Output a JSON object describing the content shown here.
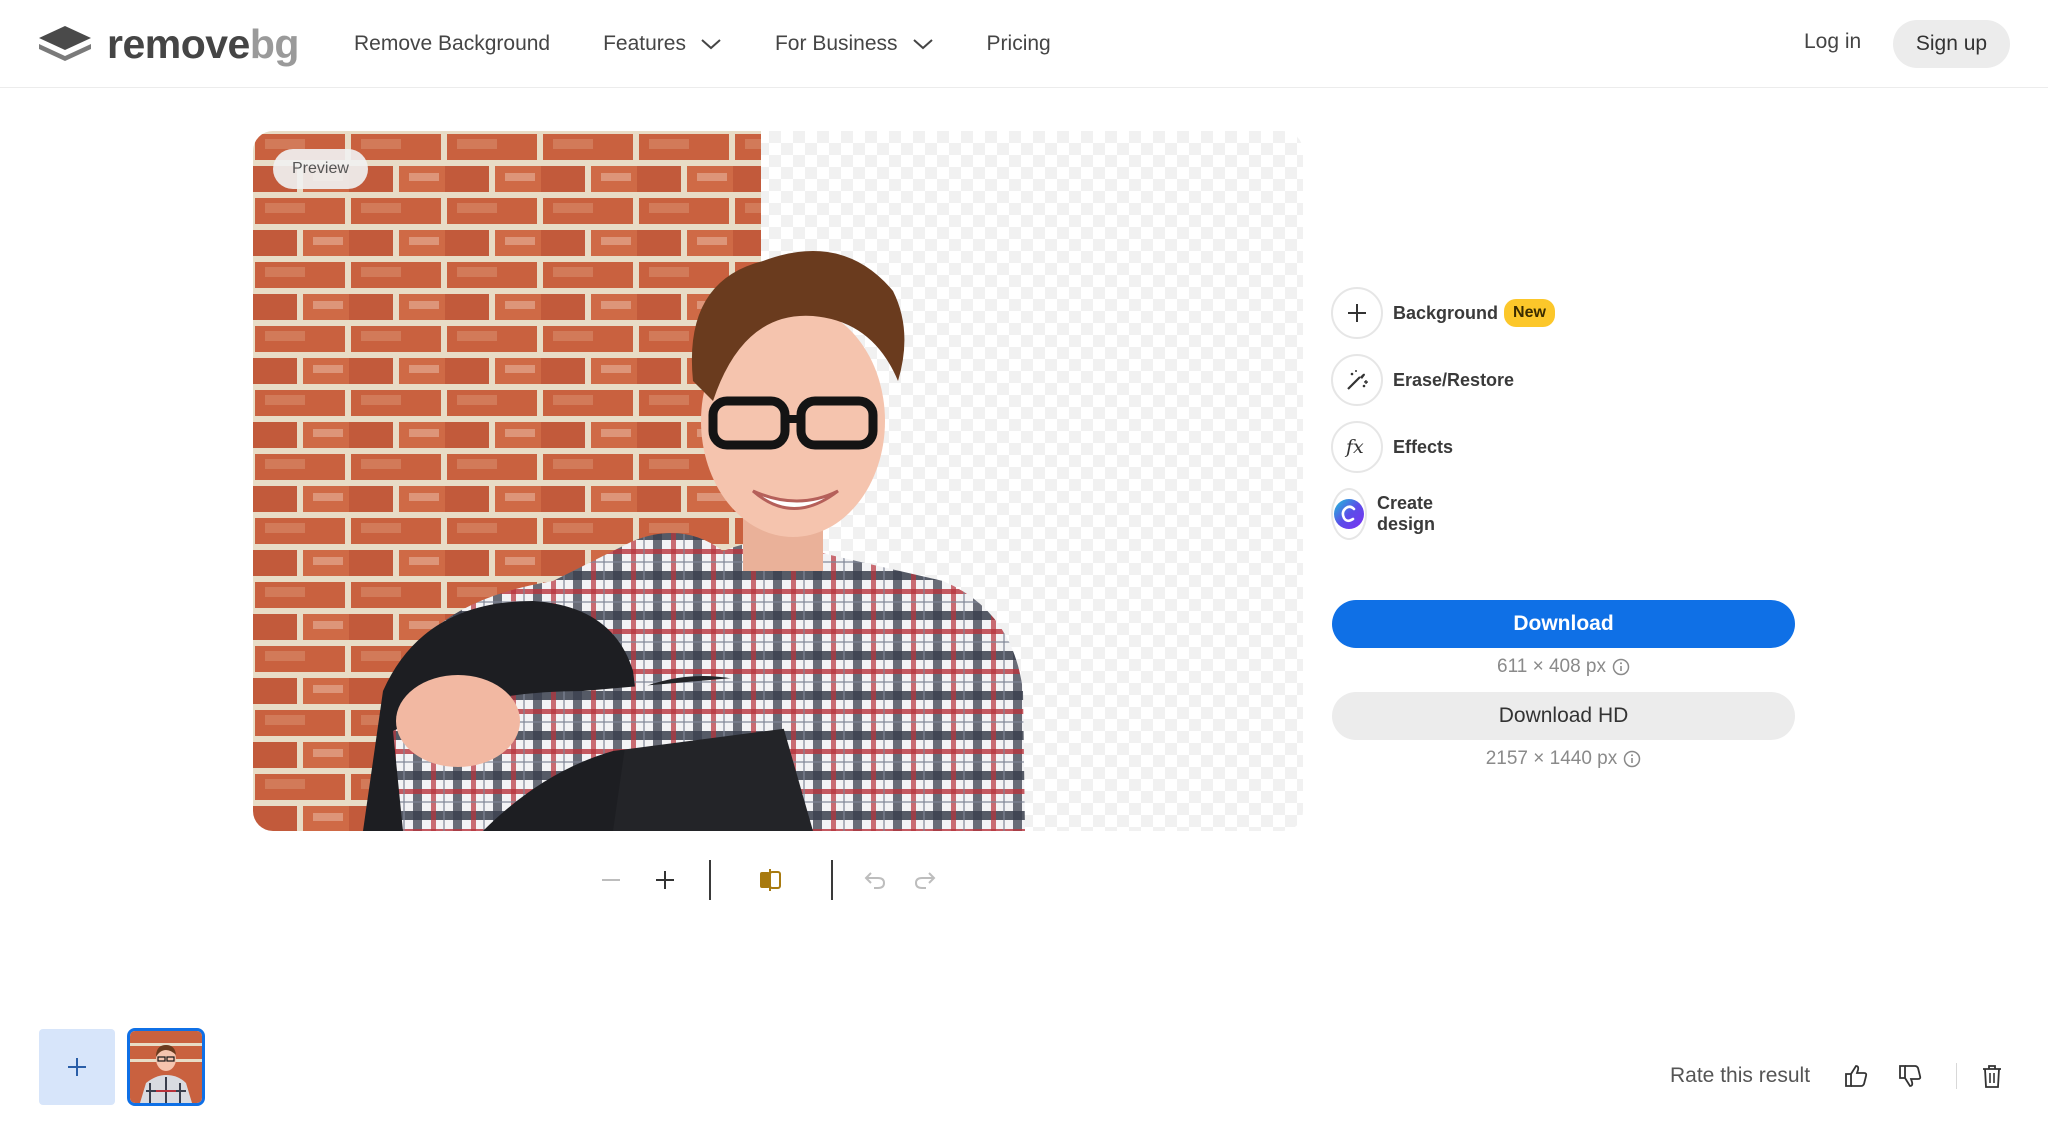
{
  "header": {
    "logo_word_dark": "remove",
    "logo_word_light": "bg",
    "nav": [
      {
        "label": "Remove Background",
        "has_dropdown": false
      },
      {
        "label": "Features",
        "has_dropdown": true
      },
      {
        "label": "For Business",
        "has_dropdown": true
      },
      {
        "label": "Pricing",
        "has_dropdown": false
      }
    ],
    "login_label": "Log in",
    "signup_label": "Sign up"
  },
  "preview": {
    "badge_label": "Preview"
  },
  "toolbar": {
    "icons": [
      "zoom-out-icon",
      "zoom-in-icon",
      "compare-icon",
      "undo-icon",
      "redo-icon"
    ]
  },
  "tools": [
    {
      "label": "Background",
      "icon": "plus-icon",
      "badge": "New"
    },
    {
      "label": "Erase/Restore",
      "icon": "magic-brush-icon"
    },
    {
      "label": "Effects",
      "icon": "fx-icon"
    },
    {
      "label": "Create design",
      "icon": "canva-icon"
    }
  ],
  "download": {
    "label": "Download",
    "size": "611 × 408 px",
    "hd_label": "Download HD",
    "hd_size": "2157 × 1440 px"
  },
  "footer": {
    "rate_label": "Rate this result"
  },
  "colors": {
    "accent": "#0f70e6",
    "badge_new": "#fcc72a",
    "add_tile": "#d7e5fa"
  }
}
